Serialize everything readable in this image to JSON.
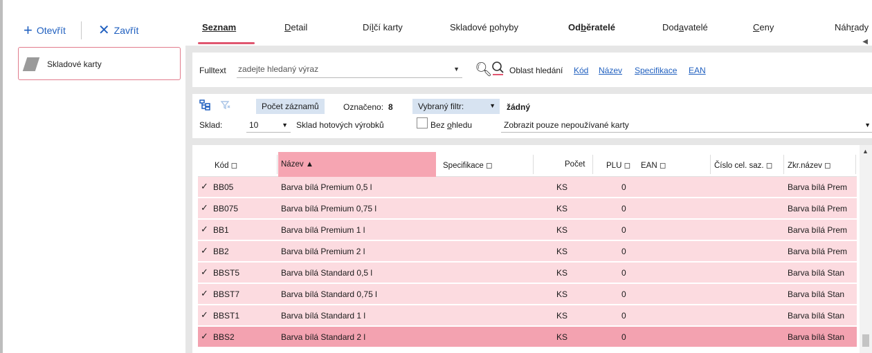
{
  "left_panel": {
    "open_label": "Otevřít",
    "close_label": "Zavřít",
    "item_label": "Skladové karty"
  },
  "tabs": [
    {
      "pre": "",
      "u": "Seznam",
      "post": ""
    },
    {
      "pre": "",
      "u": "D",
      "post": "etail"
    },
    {
      "pre": "Dí",
      "u": "l",
      "post": "čí karty"
    },
    {
      "pre": "Skladové ",
      "u": "p",
      "post": "ohyby"
    },
    {
      "pre": "Od",
      "u": "b",
      "post": "ěratelé"
    },
    {
      "pre": "Dod",
      "u": "a",
      "post": "vatelé"
    },
    {
      "pre": "",
      "u": "C",
      "post": "eny"
    },
    {
      "pre": "Náh",
      "u": "r",
      "post": "ady"
    }
  ],
  "search": {
    "label": "Fulltext",
    "placeholder": "zadejte hledaný výraz",
    "area_label": "Oblast hledání",
    "links": [
      "Kód",
      "Název",
      "Specifikace",
      "EAN"
    ]
  },
  "filter": {
    "count_button": "Počet záznamů",
    "marked_label": "Označeno:",
    "marked_value": "8",
    "selected_filter_label": "Vybraný filtr:",
    "selected_filter_value": "žádný",
    "sklad_label": "Sklad:",
    "sklad_value": "10",
    "sklad_name": "Sklad hotových výrobků",
    "bez_pre": "Bez ",
    "bez_u": "o",
    "bez_post": "hledu",
    "unused_option": "Zobrazit pouze nepoužívané karty"
  },
  "table": {
    "columns": {
      "kod": "Kód ◻",
      "nazev": "Název ▲",
      "spec": "Specifikace ◻",
      "pocet": "Počet",
      "plu": "PLU ◻",
      "ean": "EAN ◻",
      "cislo": "Číslo cel. saz. ◻",
      "zkr": "Zkr.název ◻"
    },
    "rows": [
      {
        "kod": "BB05",
        "nazev": "Barva bílá Premium 0,5 l",
        "jednotka": "KS",
        "plu": "0",
        "zkr": "Barva bílá Prem"
      },
      {
        "kod": "BB075",
        "nazev": "Barva bílá Premium 0,75 l",
        "jednotka": "KS",
        "plu": "0",
        "zkr": "Barva bílá Prem"
      },
      {
        "kod": "BB1",
        "nazev": "Barva bílá Premium 1 l",
        "jednotka": "KS",
        "plu": "0",
        "zkr": "Barva bílá Prem"
      },
      {
        "kod": "BB2",
        "nazev": "Barva bílá Premium 2 l",
        "jednotka": "KS",
        "plu": "0",
        "zkr": "Barva bílá Prem"
      },
      {
        "kod": "BBST5",
        "nazev": "Barva bílá Standard 0,5 l",
        "jednotka": "KS",
        "plu": "0",
        "zkr": "Barva bílá Stan"
      },
      {
        "kod": "BBST7",
        "nazev": "Barva bílá Standard 0,75 l",
        "jednotka": "KS",
        "plu": "0",
        "zkr": "Barva bílá Stan"
      },
      {
        "kod": "BBST1",
        "nazev": "Barva bílá Standard 1 l",
        "jednotka": "KS",
        "plu": "0",
        "zkr": "Barva bílá Stan"
      },
      {
        "kod": "BBS2",
        "nazev": "Barva bílá Standard 2 l",
        "jednotka": "KS",
        "plu": "0",
        "zkr": "Barva bílá Stan"
      }
    ]
  },
  "colors": {
    "accent_pink": "#e0566f",
    "row_pink": "#fcdbe0",
    "row_selected": "#f3a2b0",
    "link_blue": "#1f5fbf"
  }
}
